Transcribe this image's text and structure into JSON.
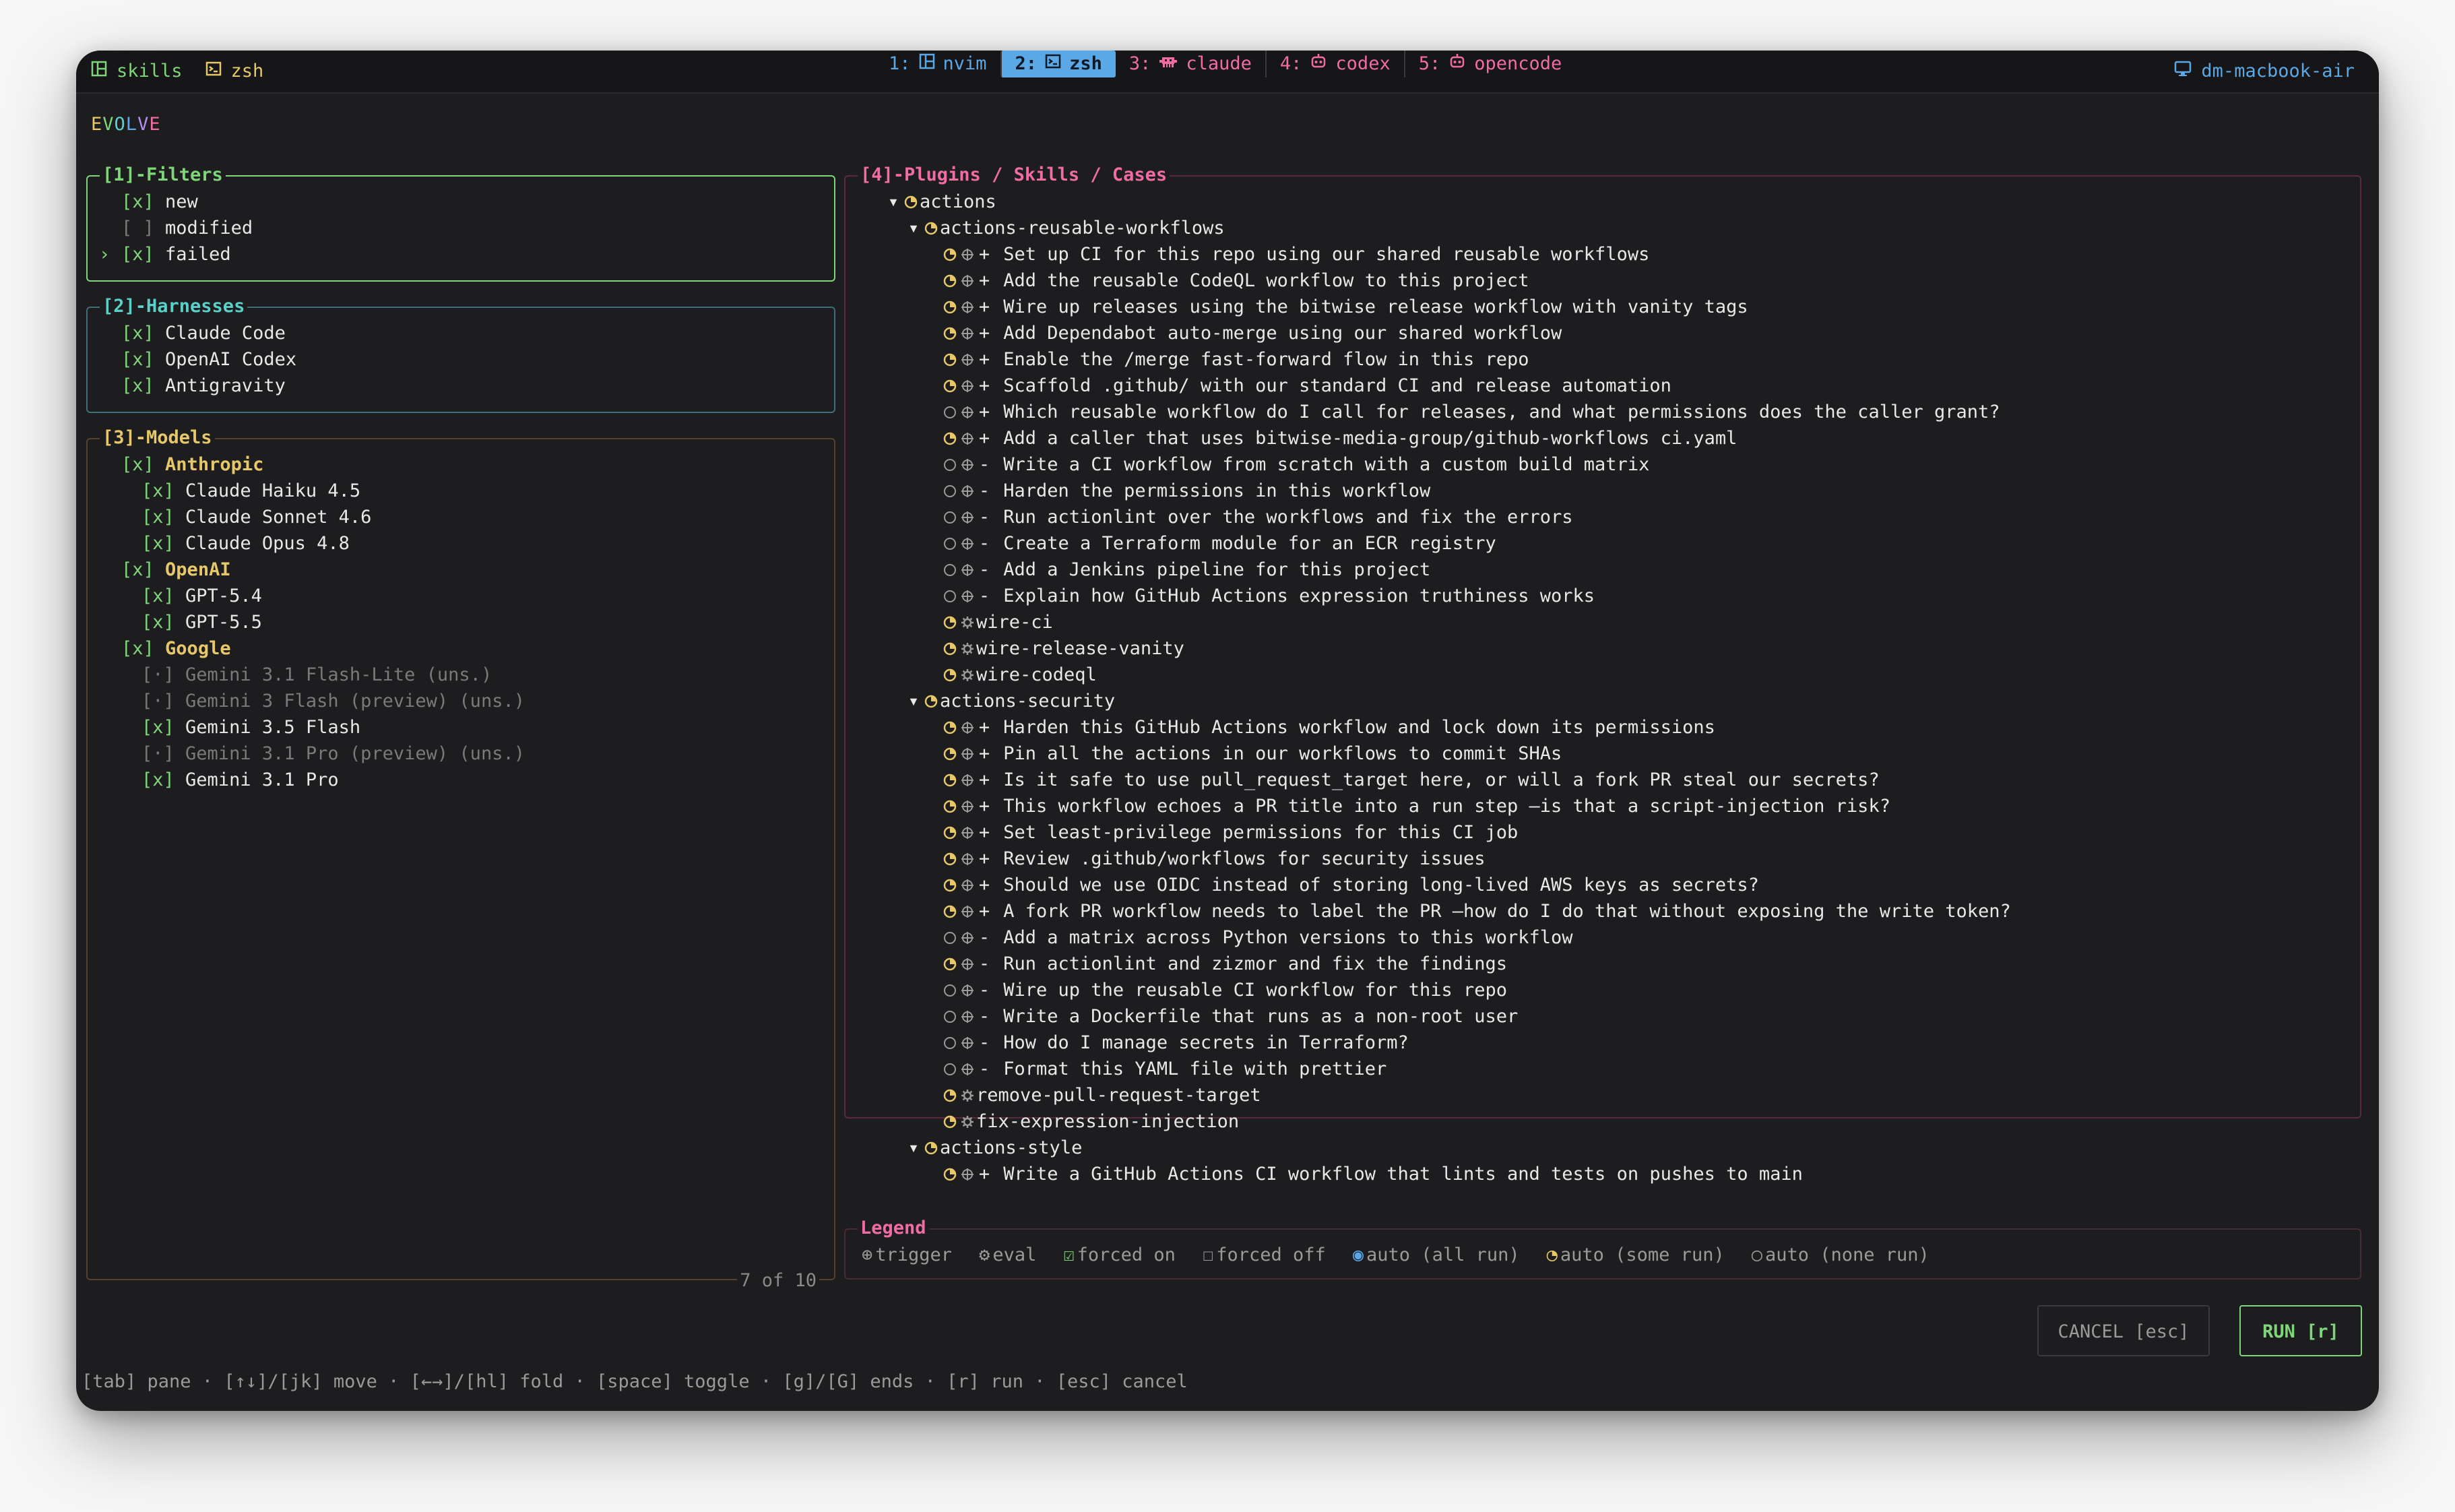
{
  "topbar": {
    "left": [
      {
        "icon": "layout-icon",
        "label": "skills"
      },
      {
        "icon": "terminal-icon",
        "label": "zsh"
      }
    ],
    "workspaces": [
      {
        "num": "1:",
        "icon": "layout-icon",
        "label": "nvim",
        "active": false
      },
      {
        "num": "2:",
        "icon": "terminal-icon",
        "label": "zsh",
        "active": true
      },
      {
        "num": "3:",
        "icon": "bot-icon",
        "label": "claude",
        "active": false
      },
      {
        "num": "4:",
        "icon": "robot-icon",
        "label": "codex",
        "active": false
      },
      {
        "num": "5:",
        "icon": "robot-icon",
        "label": "opencode",
        "active": false
      }
    ],
    "host": "dm-macbook-air"
  },
  "app_title_letters": [
    "E",
    "V",
    "O",
    "L",
    "V",
    "E"
  ],
  "filters": {
    "title": "[1]-Filters",
    "items": [
      {
        "check": "[x]",
        "label": "new",
        "cursor": ""
      },
      {
        "check": "[ ]",
        "label": "modified",
        "cursor": ""
      },
      {
        "check": "[x]",
        "label": "failed",
        "cursor": "›"
      }
    ]
  },
  "harnesses": {
    "title": "[2]-Harnesses",
    "items": [
      {
        "check": "[x]",
        "label": "Claude Code"
      },
      {
        "check": "[x]",
        "label": "OpenAI Codex"
      },
      {
        "check": "[x]",
        "label": "Antigravity"
      }
    ]
  },
  "models": {
    "title": "[3]-Models",
    "counter": "7 of 10",
    "groups": [
      {
        "check": "[x]",
        "label": "Anthropic",
        "items": [
          {
            "check": "[x]",
            "label": "Claude Haiku 4.5",
            "dim": false
          },
          {
            "check": "[x]",
            "label": "Claude Sonnet 4.6",
            "dim": false
          },
          {
            "check": "[x]",
            "label": "Claude Opus 4.8",
            "dim": false
          }
        ]
      },
      {
        "check": "[x]",
        "label": "OpenAI",
        "items": [
          {
            "check": "[x]",
            "label": "GPT-5.4",
            "dim": false
          },
          {
            "check": "[x]",
            "label": "GPT-5.5",
            "dim": false
          }
        ]
      },
      {
        "check": "[x]",
        "label": "Google",
        "items": [
          {
            "check": "[·]",
            "label": "Gemini 3.1 Flash-Lite (uns.)",
            "dim": true
          },
          {
            "check": "[·]",
            "label": "Gemini 3 Flash (preview) (uns.)",
            "dim": true
          },
          {
            "check": "[x]",
            "label": "Gemini 3.5 Flash",
            "dim": false
          },
          {
            "check": "[·]",
            "label": "Gemini 3.1 Pro (preview) (uns.)",
            "dim": true
          },
          {
            "check": "[x]",
            "label": "Gemini 3.1 Pro",
            "dim": false
          }
        ]
      }
    ]
  },
  "cases": {
    "title": "[4]-Plugins / Skills / Cases",
    "rows": [
      {
        "level": 0,
        "arrow": "▾",
        "status": "some",
        "label": "actions"
      },
      {
        "level": 1,
        "arrow": "▾",
        "status": "some",
        "label": "actions-reusable-workflows"
      },
      {
        "level": 2,
        "status": "some",
        "kind": "trigger",
        "sign": "+",
        "label": "Set up CI for this repo using our shared reusable workflows"
      },
      {
        "level": 2,
        "status": "some",
        "kind": "trigger",
        "sign": "+",
        "label": "Add the reusable CodeQL workflow to this project"
      },
      {
        "level": 2,
        "status": "some",
        "kind": "trigger",
        "sign": "+",
        "label": "Wire up releases using the bitwise release workflow with vanity tags"
      },
      {
        "level": 2,
        "status": "some",
        "kind": "trigger",
        "sign": "+",
        "label": "Add Dependabot auto-merge using our shared workflow"
      },
      {
        "level": 2,
        "status": "some",
        "kind": "trigger",
        "sign": "+",
        "label": "Enable the /merge fast-forward flow in this repo"
      },
      {
        "level": 2,
        "status": "some",
        "kind": "trigger",
        "sign": "+",
        "label": "Scaffold .github/ with our standard CI and release automation"
      },
      {
        "level": 2,
        "status": "none",
        "kind": "trigger",
        "sign": "+",
        "label": "Which reusable workflow do I call for releases, and what permissions does the caller grant?"
      },
      {
        "level": 2,
        "status": "some",
        "kind": "trigger",
        "sign": "+",
        "label": "Add a caller that uses bitwise-media-group/github-workflows ci.yaml"
      },
      {
        "level": 2,
        "status": "none",
        "kind": "trigger",
        "sign": "-",
        "label": "Write a CI workflow from scratch with a custom build matrix"
      },
      {
        "level": 2,
        "status": "none",
        "kind": "trigger",
        "sign": "-",
        "label": "Harden the permissions in this workflow"
      },
      {
        "level": 2,
        "status": "none",
        "kind": "trigger",
        "sign": "-",
        "label": "Run actionlint over the workflows and fix the errors"
      },
      {
        "level": 2,
        "status": "none",
        "kind": "trigger",
        "sign": "-",
        "label": "Create a Terraform module for an ECR registry"
      },
      {
        "level": 2,
        "status": "none",
        "kind": "trigger",
        "sign": "-",
        "label": "Add a Jenkins pipeline for this project"
      },
      {
        "level": 2,
        "status": "none",
        "kind": "trigger",
        "sign": "-",
        "label": "Explain how GitHub Actions expression truthiness works"
      },
      {
        "level": 2,
        "status": "some",
        "kind": "eval",
        "sign": "",
        "label": "wire-ci"
      },
      {
        "level": 2,
        "status": "some",
        "kind": "eval",
        "sign": "",
        "label": "wire-release-vanity"
      },
      {
        "level": 2,
        "status": "some",
        "kind": "eval",
        "sign": "",
        "label": "wire-codeql"
      },
      {
        "level": 1,
        "arrow": "▾",
        "status": "some",
        "label": "actions-security"
      },
      {
        "level": 2,
        "status": "some",
        "kind": "trigger",
        "sign": "+",
        "label": "Harden this GitHub Actions workflow and lock down its permissions"
      },
      {
        "level": 2,
        "status": "some",
        "kind": "trigger",
        "sign": "+",
        "label": "Pin all the actions in our workflows to commit SHAs"
      },
      {
        "level": 2,
        "status": "some",
        "kind": "trigger",
        "sign": "+",
        "label": "Is it safe to use pull_request_target here, or will a fork PR steal our secrets?"
      },
      {
        "level": 2,
        "status": "some",
        "kind": "trigger",
        "sign": "+",
        "label": "This workflow echoes a PR title into a run step —is that a script-injection risk?"
      },
      {
        "level": 2,
        "status": "some",
        "kind": "trigger",
        "sign": "+",
        "label": "Set least-privilege permissions for this CI job"
      },
      {
        "level": 2,
        "status": "some",
        "kind": "trigger",
        "sign": "+",
        "label": "Review .github/workflows for security issues"
      },
      {
        "level": 2,
        "status": "some",
        "kind": "trigger",
        "sign": "+",
        "label": "Should we use OIDC instead of storing long-lived AWS keys as secrets?"
      },
      {
        "level": 2,
        "status": "some",
        "kind": "trigger",
        "sign": "+",
        "label": "A fork PR workflow needs to label the PR —how do I do that without exposing the write token?"
      },
      {
        "level": 2,
        "status": "none",
        "kind": "trigger",
        "sign": "-",
        "label": "Add a matrix across Python versions to this workflow"
      },
      {
        "level": 2,
        "status": "some",
        "kind": "trigger",
        "sign": "-",
        "label": "Run actionlint and zizmor and fix the findings"
      },
      {
        "level": 2,
        "status": "none",
        "kind": "trigger",
        "sign": "-",
        "label": "Wire up the reusable CI workflow for this repo"
      },
      {
        "level": 2,
        "status": "none",
        "kind": "trigger",
        "sign": "-",
        "label": "Write a Dockerfile that runs as a non-root user"
      },
      {
        "level": 2,
        "status": "none",
        "kind": "trigger",
        "sign": "-",
        "label": "How do I manage secrets in Terraform?"
      },
      {
        "level": 2,
        "status": "none",
        "kind": "trigger",
        "sign": "-",
        "label": "Format this YAML file with prettier"
      },
      {
        "level": 2,
        "status": "some",
        "kind": "eval",
        "sign": "",
        "label": "remove-pull-request-target"
      },
      {
        "level": 2,
        "status": "some",
        "kind": "eval",
        "sign": "",
        "label": "fix-expression-injection"
      },
      {
        "level": 1,
        "arrow": "▾",
        "status": "some",
        "label": "actions-style"
      },
      {
        "level": 2,
        "status": "some",
        "kind": "trigger",
        "sign": "+",
        "label": "Write a GitHub Actions CI workflow that lints and tests on pushes to main"
      }
    ]
  },
  "legend": {
    "title": "Legend",
    "items": [
      {
        "sym": "⊕",
        "label": "trigger",
        "color": "#9a9a9a"
      },
      {
        "sym": "⚙",
        "label": "eval",
        "color": "#9a9a9a"
      },
      {
        "sym": "☑",
        "label": "forced on",
        "color": "#7fd67a"
      },
      {
        "sym": "☐",
        "label": "forced off",
        "color": "#9a9a9a"
      },
      {
        "sym": "◉",
        "label": "auto (all run)",
        "color": "#5aa8e6"
      },
      {
        "sym": "◔",
        "label": "auto (some run)",
        "color": "#e6c86a"
      },
      {
        "sym": "○",
        "label": "auto (none run)",
        "color": "#9a9a9a"
      }
    ]
  },
  "buttons": {
    "cancel": "CANCEL [esc]",
    "run": "RUN [r]"
  },
  "hint": "[tab] pane · [↑↓]/[jk] move · [←→]/[hl] fold · [space] toggle · [g]/[G] ends · [r] run · [esc] cancel",
  "colors": {
    "accent_green": "#7fd67a",
    "accent_blue": "#5aa8e6",
    "accent_yellow": "#e6c86a",
    "accent_pink": "#f06ca3"
  }
}
